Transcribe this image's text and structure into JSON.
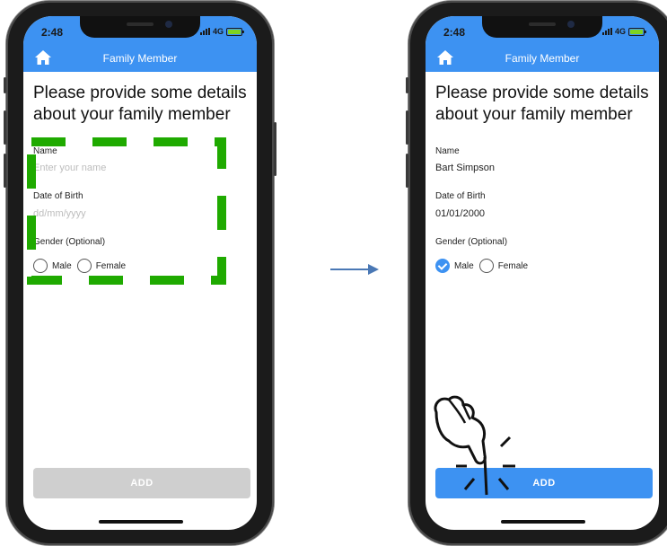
{
  "before": {
    "status": {
      "time": "2:48",
      "network": "4G"
    },
    "nav": {
      "title": "Family Member",
      "home_icon": "home-icon"
    },
    "heading": "Please provide some details about your family member",
    "name": {
      "label": "Name",
      "placeholder": "Enter your name"
    },
    "dob": {
      "label": "Date of Birth",
      "placeholder": "dd/mm/yyyy"
    },
    "gender": {
      "label": "Gender (Optional)",
      "options": [
        "Male",
        "Female"
      ],
      "selected": null
    },
    "add_button": {
      "label": "ADD",
      "state": "disabled"
    }
  },
  "after": {
    "status": {
      "time": "2:48",
      "network": "4G"
    },
    "nav": {
      "title": "Family Member",
      "home_icon": "home-icon"
    },
    "heading": "Please provide some details about your family member",
    "name": {
      "label": "Name",
      "value": "Bart Simpson"
    },
    "dob": {
      "label": "Date of Birth",
      "value": "01/01/2000"
    },
    "gender": {
      "label": "Gender (Optional)",
      "options": [
        "Male",
        "Female"
      ],
      "selected": "Male"
    },
    "add_button": {
      "label": "ADD",
      "state": "enabled"
    }
  },
  "colors": {
    "accent": "#3d92f2",
    "highlight_dash": "#1faa00",
    "arrow": "#4a78b5",
    "disabled_button": "#cfcfcf"
  },
  "annotations": {
    "highlight": "dashed-box-icon",
    "transition": "right-arrow-icon",
    "tap": "tapping-hand-icon"
  }
}
